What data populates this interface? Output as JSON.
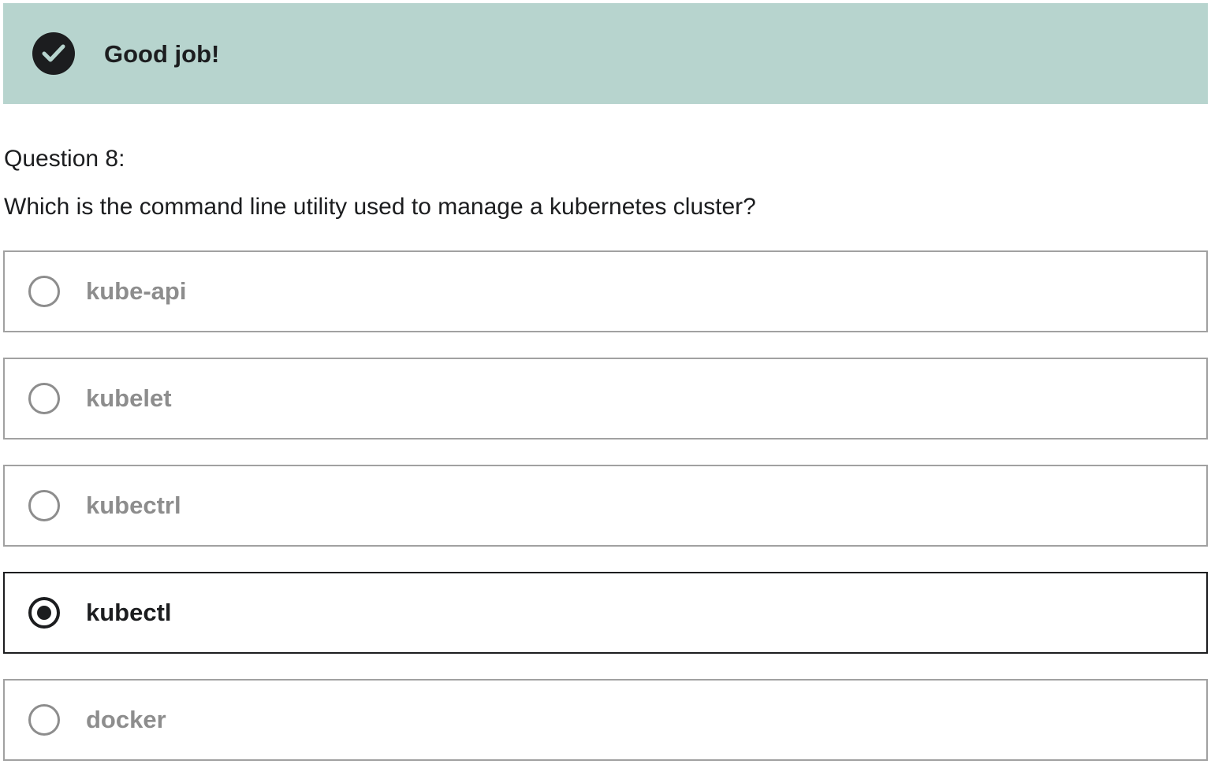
{
  "banner": {
    "title": "Good job!",
    "icon": "check-circle-icon",
    "background": "#b7d4ce"
  },
  "question": {
    "number_label": "Question 8:",
    "text": "Which is the command line utility used to manage a kubernetes cluster?"
  },
  "options": [
    {
      "label": "kube-api",
      "selected": false
    },
    {
      "label": "kubelet",
      "selected": false
    },
    {
      "label": "kubectrl",
      "selected": false
    },
    {
      "label": "kubectl",
      "selected": true
    },
    {
      "label": "docker",
      "selected": false
    }
  ],
  "colors": {
    "text": "#1c1d1f",
    "muted": "#8d8d8d",
    "border": "#a1a1a1"
  }
}
